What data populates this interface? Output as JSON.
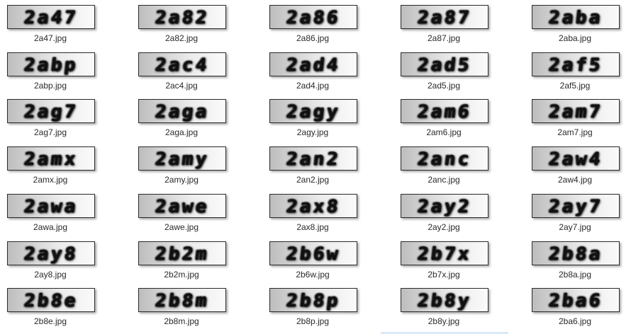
{
  "files": [
    {
      "captcha": "2a47",
      "name": "2a47.jpg"
    },
    {
      "captcha": "2a82",
      "name": "2a82.jpg"
    },
    {
      "captcha": "2a86",
      "name": "2a86.jpg"
    },
    {
      "captcha": "2a87",
      "name": "2a87.jpg"
    },
    {
      "captcha": "2aba",
      "name": "2aba.jpg"
    },
    {
      "captcha": "2abp",
      "name": "2abp.jpg"
    },
    {
      "captcha": "2ac4",
      "name": "2ac4.jpg"
    },
    {
      "captcha": "2ad4",
      "name": "2ad4.jpg"
    },
    {
      "captcha": "2ad5",
      "name": "2ad5.jpg"
    },
    {
      "captcha": "2af5",
      "name": "2af5.jpg"
    },
    {
      "captcha": "2ag7",
      "name": "2ag7.jpg"
    },
    {
      "captcha": "2aga",
      "name": "2aga.jpg"
    },
    {
      "captcha": "2agy",
      "name": "2agy.jpg"
    },
    {
      "captcha": "2am6",
      "name": "2am6.jpg"
    },
    {
      "captcha": "2am7",
      "name": "2am7.jpg"
    },
    {
      "captcha": "2amx",
      "name": "2amx.jpg"
    },
    {
      "captcha": "2amy",
      "name": "2amy.jpg"
    },
    {
      "captcha": "2an2",
      "name": "2an2.jpg"
    },
    {
      "captcha": "2anc",
      "name": "2anc.jpg"
    },
    {
      "captcha": "2aw4",
      "name": "2aw4.jpg"
    },
    {
      "captcha": "2awa",
      "name": "2awa.jpg"
    },
    {
      "captcha": "2awe",
      "name": "2awe.jpg"
    },
    {
      "captcha": "2ax8",
      "name": "2ax8.jpg"
    },
    {
      "captcha": "2ay2",
      "name": "2ay2.jpg"
    },
    {
      "captcha": "2ay7",
      "name": "2ay7.jpg"
    },
    {
      "captcha": "2ay8",
      "name": "2ay8.jpg"
    },
    {
      "captcha": "2b2m",
      "name": "2b2m.jpg"
    },
    {
      "captcha": "2b6w",
      "name": "2b6w.jpg"
    },
    {
      "captcha": "2b7x",
      "name": "2b7x.jpg"
    },
    {
      "captcha": "2b8a",
      "name": "2b8a.jpg"
    },
    {
      "captcha": "2b8e",
      "name": "2b8e.jpg"
    },
    {
      "captcha": "2b8m",
      "name": "2b8m.jpg"
    },
    {
      "captcha": "2b8p",
      "name": "2b8p.jpg"
    },
    {
      "captcha": "2b8y",
      "name": "2b8y.jpg"
    },
    {
      "captcha": "2ba6",
      "name": "2ba6.jpg"
    }
  ]
}
